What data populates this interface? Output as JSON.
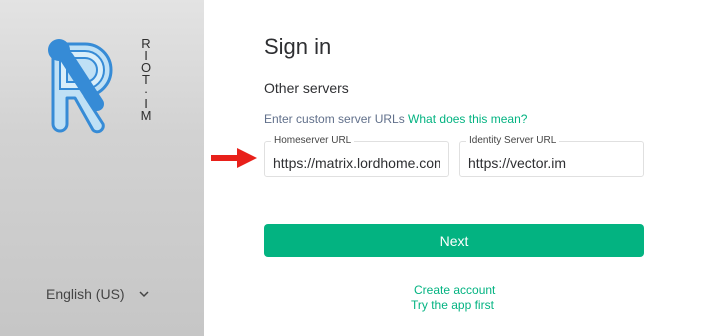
{
  "brand": {
    "logo_letters": [
      "R",
      "I",
      "O",
      "T",
      "·",
      "I",
      "M"
    ],
    "logo_icon": "riot-r-logo-icon",
    "colors": {
      "logo_blue": "#368bd6",
      "logo_light": "#b8d9f3"
    }
  },
  "language": {
    "selected": "English (US)",
    "icon": "chevron-down-icon"
  },
  "login": {
    "title": "Sign in",
    "section_title": "Other servers",
    "hint_text": "Enter custom server URLs ",
    "hint_link": "What does this mean?",
    "homeserver": {
      "label": "Homeserver URL",
      "value": "https://matrix.lordhome.com"
    },
    "identity_server": {
      "label": "Identity Server URL",
      "value": "https://vector.im"
    },
    "next_label": "Next",
    "create_account_label": "Create account",
    "try_app_label": "Try the app first"
  },
  "colors": {
    "accent": "#03b381",
    "arrow": "#e8201a",
    "text": "#2e2f32"
  }
}
